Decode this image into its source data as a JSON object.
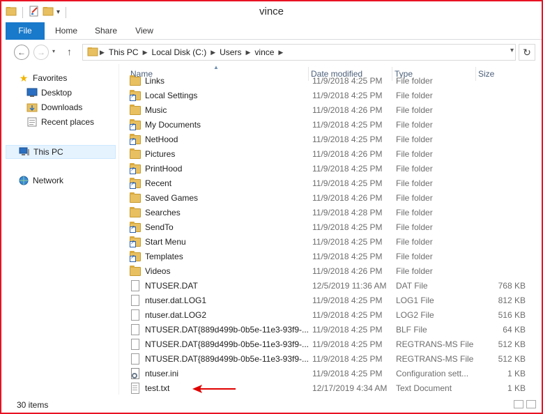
{
  "window": {
    "title": "vince"
  },
  "ribbon": {
    "tabs": [
      "File",
      "Home",
      "Share",
      "View"
    ]
  },
  "address": {
    "crumbs": [
      "This PC",
      "Local Disk (C:)",
      "Users",
      "vince"
    ]
  },
  "navpane": {
    "favorites_label": "Favorites",
    "favorites": [
      "Desktop",
      "Downloads",
      "Recent places"
    ],
    "this_pc_label": "This PC",
    "network_label": "Network"
  },
  "columns": {
    "name": "Name",
    "date": "Date modified",
    "type": "Type",
    "size": "Size"
  },
  "files": [
    {
      "name": "Links",
      "date": "11/9/2018 4:25 PM",
      "type": "File folder",
      "size": "",
      "icon": "folder-icon"
    },
    {
      "name": "Local Settings",
      "date": "11/9/2018 4:25 PM",
      "type": "File folder",
      "size": "",
      "icon": "folder-shortcut-icon"
    },
    {
      "name": "Music",
      "date": "11/9/2018 4:26 PM",
      "type": "File folder",
      "size": "",
      "icon": "folder-icon"
    },
    {
      "name": "My Documents",
      "date": "11/9/2018 4:25 PM",
      "type": "File folder",
      "size": "",
      "icon": "folder-shortcut-icon"
    },
    {
      "name": "NetHood",
      "date": "11/9/2018 4:25 PM",
      "type": "File folder",
      "size": "",
      "icon": "folder-shortcut-icon"
    },
    {
      "name": "Pictures",
      "date": "11/9/2018 4:26 PM",
      "type": "File folder",
      "size": "",
      "icon": "folder-icon"
    },
    {
      "name": "PrintHood",
      "date": "11/9/2018 4:25 PM",
      "type": "File folder",
      "size": "",
      "icon": "folder-shortcut-icon"
    },
    {
      "name": "Recent",
      "date": "11/9/2018 4:25 PM",
      "type": "File folder",
      "size": "",
      "icon": "folder-shortcut-icon"
    },
    {
      "name": "Saved Games",
      "date": "11/9/2018 4:26 PM",
      "type": "File folder",
      "size": "",
      "icon": "folder-icon"
    },
    {
      "name": "Searches",
      "date": "11/9/2018 4:28 PM",
      "type": "File folder",
      "size": "",
      "icon": "folder-icon"
    },
    {
      "name": "SendTo",
      "date": "11/9/2018 4:25 PM",
      "type": "File folder",
      "size": "",
      "icon": "folder-shortcut-icon"
    },
    {
      "name": "Start Menu",
      "date": "11/9/2018 4:25 PM",
      "type": "File folder",
      "size": "",
      "icon": "folder-shortcut-icon"
    },
    {
      "name": "Templates",
      "date": "11/9/2018 4:25 PM",
      "type": "File folder",
      "size": "",
      "icon": "folder-shortcut-icon"
    },
    {
      "name": "Videos",
      "date": "11/9/2018 4:26 PM",
      "type": "File folder",
      "size": "",
      "icon": "folder-icon"
    },
    {
      "name": "NTUSER.DAT",
      "date": "12/5/2019 11:36 AM",
      "type": "DAT File",
      "size": "768 KB",
      "icon": "file-icon"
    },
    {
      "name": "ntuser.dat.LOG1",
      "date": "11/9/2018 4:25 PM",
      "type": "LOG1 File",
      "size": "812 KB",
      "icon": "file-icon"
    },
    {
      "name": "ntuser.dat.LOG2",
      "date": "11/9/2018 4:25 PM",
      "type": "LOG2 File",
      "size": "516 KB",
      "icon": "file-icon"
    },
    {
      "name": "NTUSER.DAT{889d499b-0b5e-11e3-93f9-...",
      "date": "11/9/2018 4:25 PM",
      "type": "BLF File",
      "size": "64 KB",
      "icon": "file-icon"
    },
    {
      "name": "NTUSER.DAT{889d499b-0b5e-11e3-93f9-...",
      "date": "11/9/2018 4:25 PM",
      "type": "REGTRANS-MS File",
      "size": "512 KB",
      "icon": "file-icon"
    },
    {
      "name": "NTUSER.DAT{889d499b-0b5e-11e3-93f9-...",
      "date": "11/9/2018 4:25 PM",
      "type": "REGTRANS-MS File",
      "size": "512 KB",
      "icon": "file-icon"
    },
    {
      "name": "ntuser.ini",
      "date": "11/9/2018 4:25 PM",
      "type": "Configuration sett...",
      "size": "1 KB",
      "icon": "settings-file-icon"
    },
    {
      "name": "test.txt",
      "date": "12/17/2019 4:34 AM",
      "type": "Text Document",
      "size": "1 KB",
      "icon": "text-file-icon"
    }
  ],
  "status": {
    "item_count": "30 items"
  },
  "colors": {
    "accent": "#1979ca",
    "window_border": "#e81123",
    "annotation_arrow": "#e00000"
  }
}
